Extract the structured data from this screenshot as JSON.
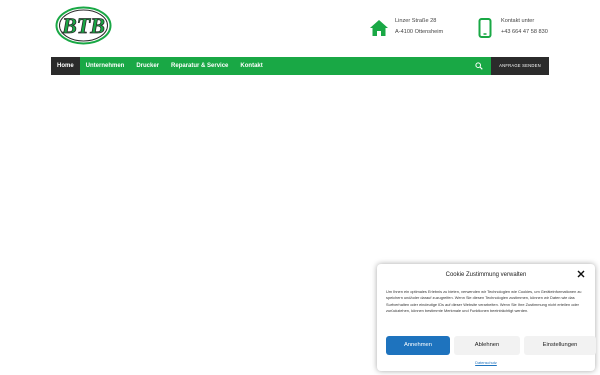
{
  "header": {
    "address": {
      "line1": "Linzer Straße 28",
      "line2": "A-4100 Ottensheim"
    },
    "phone": {
      "line1": "Kontakt unter",
      "line2": "+43 664 47 58 830"
    },
    "logo_text": "BTB"
  },
  "nav": {
    "items": [
      {
        "label": "Home"
      },
      {
        "label": "Unternehmen"
      },
      {
        "label": "Drucker"
      },
      {
        "label": "Reparatur & Service"
      },
      {
        "label": "Kontakt"
      }
    ],
    "cta_label": "ANFRAGE SENDEN"
  },
  "cookie": {
    "title": "Cookie Zustimmung verwalten",
    "text": "Um Ihnen ein optimales Erlebnis zu bieten, verwenden wir Technologien wie Cookies, um Geräteinformationen zu speichern und/oder darauf zuzugreifen. Wenn Sie diesen Technologien zustimmen, können wir Daten wie das Surfverhalten oder eindeutige IDs auf dieser Website verarbeiten. Wenn Sie Ihre Zustimmung nicht erteilen oder zurückziehen, können bestimmte Merkmale und Funktionen beeinträchtigt werden.",
    "accept_label": "Annehmen",
    "deny_label": "Ablehnen",
    "settings_label": "Einstellungen",
    "link_label": "Datenschutz"
  },
  "colors": {
    "brand_green": "#19a845",
    "nav_dark": "#2b2b2b",
    "accept_blue": "#1e73be"
  }
}
